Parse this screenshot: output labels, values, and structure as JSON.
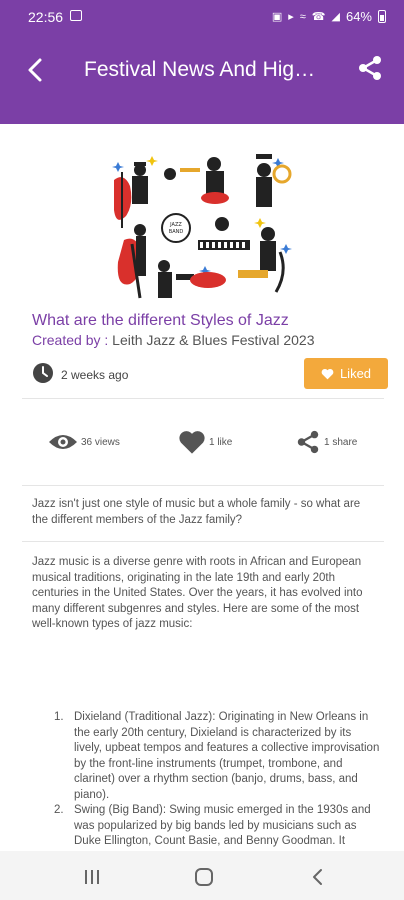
{
  "status_bar": {
    "time": "22:56",
    "battery": "64%",
    "icons": [
      "gallery-icon",
      "lock-icon",
      "mute-icon",
      "wifi-icon",
      "call-icon",
      "signal-icon",
      "battery-icon"
    ]
  },
  "app_bar": {
    "title": "Festival News And Highlights",
    "back_icon": "back-arrow-icon",
    "share_icon": "share-icon"
  },
  "post": {
    "title": "What are the different Styles of Jazz",
    "created_by_label": "Created by : ",
    "creator": "Leith Jazz & Blues Festival 2023",
    "age": "2 weeks ago",
    "liked_label": "Liked"
  },
  "stats": {
    "views": "36 views",
    "likes": "1 like",
    "shares": "1 share"
  },
  "content": {
    "intro": "Jazz isn't just one style of music but a whole family - so what are the different members of the Jazz family?",
    "paragraph": "Jazz music is a diverse genre with roots in African and European musical traditions, originating in the late 19th and early 20th centuries in the United States. Over the years, it has evolved into many different subgenres and styles. Here are some of the most well-known types of jazz music:",
    "styles": [
      {
        "num": "1.",
        "text": "Dixieland (Traditional Jazz): Originating in New Orleans in the early 20th century, Dixieland is characterized by its lively, upbeat tempos and features a collective improvisation by the front-line instruments (trumpet, trombone, and clarinet) over a rhythm section (banjo, drums, bass, and piano)."
      },
      {
        "num": "2.",
        "text": "Swing (Big Band): Swing music emerged in the 1930s and was popularized by big bands led by musicians such as Duke Ellington, Count Basie, and Benny Goodman. It emphasizes strong rhythms, catchy"
      }
    ]
  },
  "colors": {
    "primary": "#7b3fa6",
    "liked": "#f3a93c"
  }
}
